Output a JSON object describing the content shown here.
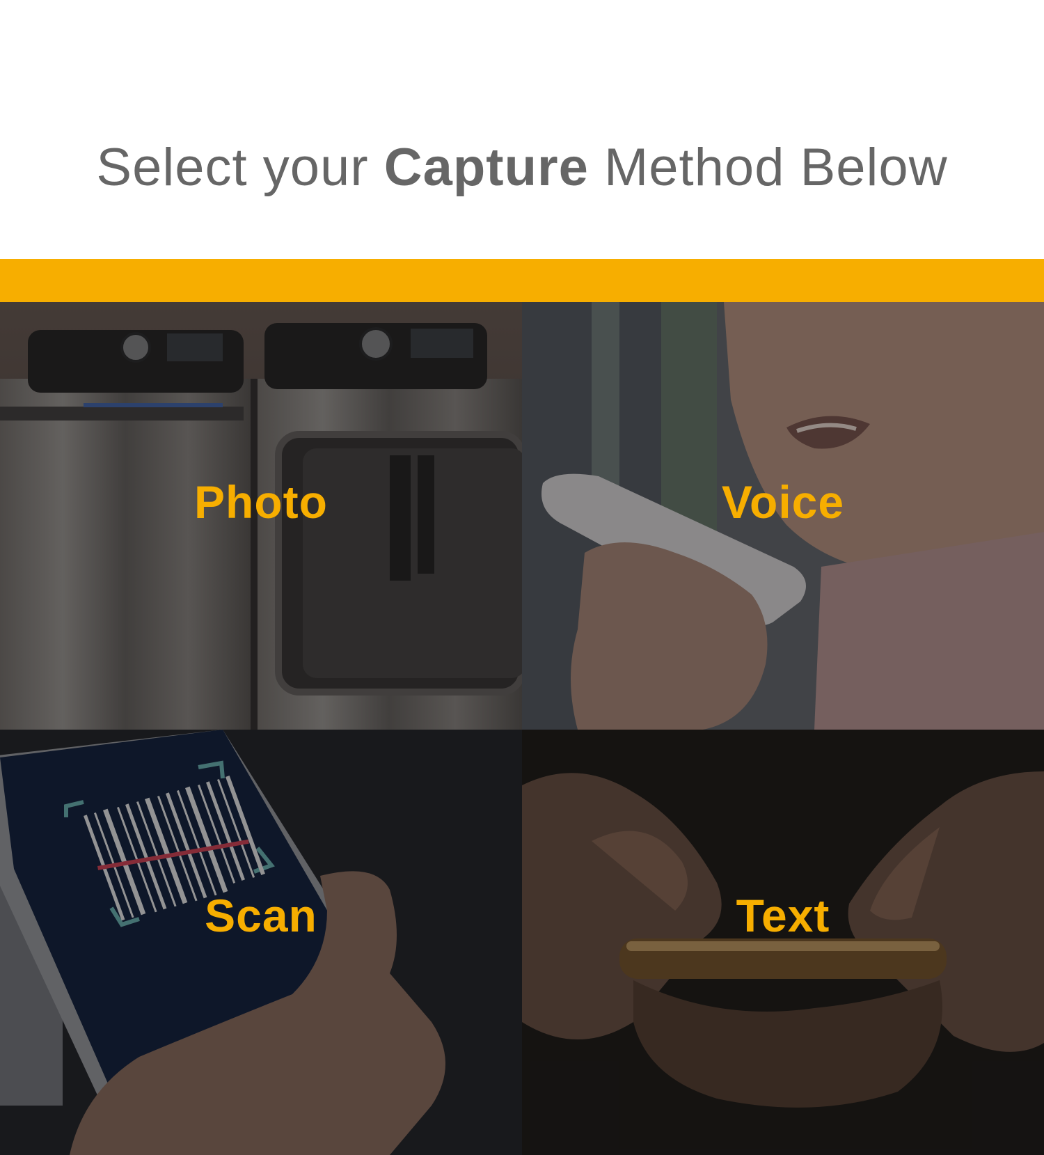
{
  "header": {
    "title_prefix": "Select your ",
    "title_emphasis": "Capture",
    "title_suffix": " Method Below"
  },
  "accent_color": "#f7ae00",
  "methods": [
    {
      "label": "Photo",
      "icon": "washer-dryer-photo"
    },
    {
      "label": "Voice",
      "icon": "person-speaking-into-phone"
    },
    {
      "label": "Scan",
      "icon": "phone-barcode-scan"
    },
    {
      "label": "Text",
      "icon": "hands-typing-on-phone"
    }
  ]
}
